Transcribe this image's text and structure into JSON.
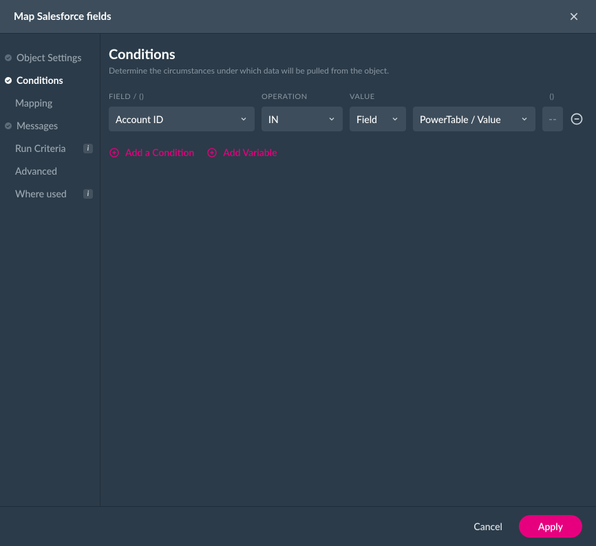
{
  "header": {
    "title": "Map Salesforce fields"
  },
  "sidebar": {
    "items": [
      {
        "label": "Object Settings",
        "checked": true,
        "active": false,
        "indented": false,
        "badge": false
      },
      {
        "label": "Conditions",
        "checked": true,
        "active": true,
        "indented": false,
        "badge": false
      },
      {
        "label": "Mapping",
        "checked": false,
        "active": false,
        "indented": true,
        "badge": false
      },
      {
        "label": "Messages",
        "checked": true,
        "active": false,
        "indented": false,
        "badge": false
      },
      {
        "label": "Run Criteria",
        "checked": false,
        "active": false,
        "indented": true,
        "badge": true
      },
      {
        "label": "Advanced",
        "checked": false,
        "active": false,
        "indented": true,
        "badge": false
      },
      {
        "label": "Where used",
        "checked": false,
        "active": false,
        "indented": true,
        "badge": true
      }
    ]
  },
  "main": {
    "title": "Conditions",
    "description": "Determine the circumstances under which data will be pulled from the object.",
    "labels": {
      "field": "FIELD / ()",
      "operation": "OPERATION",
      "value": "VALUE",
      "paren": "()"
    },
    "condition": {
      "field": "Account ID",
      "operation": "IN",
      "value_type": "Field",
      "value_pick": "PowerTable / Value",
      "paren_btn": "--"
    },
    "actions": {
      "add_condition": "Add a Condition",
      "add_variable": "Add Variable"
    }
  },
  "footer": {
    "cancel": "Cancel",
    "apply": "Apply"
  }
}
